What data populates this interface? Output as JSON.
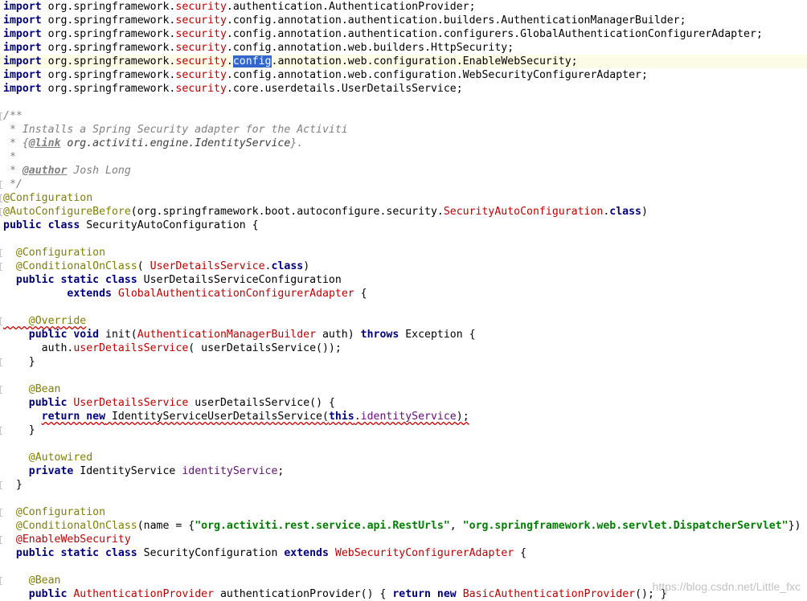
{
  "code_lines": [
    {
      "hl": false,
      "fold": false,
      "tokens": [
        {
          "t": "import",
          "c": "kw"
        },
        {
          "t": " org.springframework.",
          "c": "pkg"
        },
        {
          "t": "security",
          "c": "sec"
        },
        {
          "t": ".authentication.AuthenticationProvider;",
          "c": "pkg"
        }
      ]
    },
    {
      "hl": false,
      "fold": false,
      "tokens": [
        {
          "t": "import",
          "c": "kw"
        },
        {
          "t": " org.springframework.",
          "c": "pkg"
        },
        {
          "t": "security",
          "c": "sec"
        },
        {
          "t": ".config.annotation.authentication.builders.AuthenticationManagerBuilder;",
          "c": "pkg"
        }
      ]
    },
    {
      "hl": false,
      "fold": false,
      "tokens": [
        {
          "t": "import",
          "c": "kw"
        },
        {
          "t": " org.springframework.",
          "c": "pkg"
        },
        {
          "t": "security",
          "c": "sec"
        },
        {
          "t": ".config.annotation.authentication.configurers.GlobalAuthenticationConfigurerAdapter;",
          "c": "pkg"
        }
      ]
    },
    {
      "hl": false,
      "fold": false,
      "tokens": [
        {
          "t": "import",
          "c": "kw"
        },
        {
          "t": " org.springframework.",
          "c": "pkg"
        },
        {
          "t": "security",
          "c": "sec"
        },
        {
          "t": ".config.annotation.web.builders.HttpSecurity;",
          "c": "pkg"
        }
      ]
    },
    {
      "hl": true,
      "fold": false,
      "tokens": [
        {
          "t": "import",
          "c": "kw"
        },
        {
          "t": " org.springframework.",
          "c": "pkg"
        },
        {
          "t": "security",
          "c": "sec"
        },
        {
          "t": ".",
          "c": "pkg"
        },
        {
          "t": "config",
          "c": "sel"
        },
        {
          "t": ".annotation.web.configuration.EnableWebSecurity;",
          "c": "pkg"
        }
      ]
    },
    {
      "hl": false,
      "fold": false,
      "tokens": [
        {
          "t": "import",
          "c": "kw"
        },
        {
          "t": " org.springframework.",
          "c": "pkg"
        },
        {
          "t": "security",
          "c": "sec"
        },
        {
          "t": ".config.annotation.web.configuration.WebSecurityConfigurerAdapter;",
          "c": "pkg"
        }
      ]
    },
    {
      "hl": false,
      "fold": false,
      "tokens": [
        {
          "t": "import",
          "c": "kw"
        },
        {
          "t": " org.springframework.",
          "c": "pkg"
        },
        {
          "t": "security",
          "c": "sec"
        },
        {
          "t": ".core.userdetails.UserDetailsService;",
          "c": "pkg"
        }
      ]
    },
    {
      "hl": false,
      "fold": false,
      "tokens": []
    },
    {
      "hl": false,
      "fold": true,
      "tokens": [
        {
          "t": "/**",
          "c": "cmt"
        }
      ]
    },
    {
      "hl": false,
      "fold": false,
      "tokens": [
        {
          "t": " * Installs a Spring Security adapter for the Activiti",
          "c": "cmt"
        }
      ]
    },
    {
      "hl": false,
      "fold": false,
      "tokens": [
        {
          "t": " * {",
          "c": "cmt"
        },
        {
          "t": "@link",
          "c": "doctag"
        },
        {
          "t": " org.activiti.engine.IdentityService",
          "c": "docref"
        },
        {
          "t": "}.",
          "c": "cmt"
        }
      ]
    },
    {
      "hl": false,
      "fold": false,
      "tokens": [
        {
          "t": " *",
          "c": "cmt"
        }
      ]
    },
    {
      "hl": false,
      "fold": false,
      "tokens": [
        {
          "t": " * ",
          "c": "cmt"
        },
        {
          "t": "@author",
          "c": "doctag"
        },
        {
          "t": " Josh Long",
          "c": "cmt"
        }
      ]
    },
    {
      "hl": false,
      "fold": true,
      "tokens": [
        {
          "t": " */",
          "c": "cmt"
        }
      ]
    },
    {
      "hl": false,
      "fold": true,
      "tokens": [
        {
          "t": "@Configuration",
          "c": "ann"
        }
      ]
    },
    {
      "hl": false,
      "fold": true,
      "tokens": [
        {
          "t": "@AutoConfigureBefore",
          "c": "ann"
        },
        {
          "t": "(org.springframework.boot.autoconfigure.security.",
          "c": "plain"
        },
        {
          "t": "SecurityAutoConfiguration",
          "c": "ref"
        },
        {
          "t": ".",
          "c": "plain"
        },
        {
          "t": "class",
          "c": "kw"
        },
        {
          "t": ")",
          "c": "plain"
        }
      ]
    },
    {
      "hl": false,
      "fold": false,
      "tokens": [
        {
          "t": "public class",
          "c": "kw"
        },
        {
          "t": " SecurityAutoConfiguration {",
          "c": "plain"
        }
      ]
    },
    {
      "hl": false,
      "fold": false,
      "tokens": []
    },
    {
      "hl": false,
      "fold": true,
      "tokens": [
        {
          "t": "  @Configuration",
          "c": "ann"
        }
      ]
    },
    {
      "hl": false,
      "fold": true,
      "tokens": [
        {
          "t": "  @ConditionalOnClass",
          "c": "ann"
        },
        {
          "t": "( ",
          "c": "plain"
        },
        {
          "t": "UserDetailsService",
          "c": "ref"
        },
        {
          "t": ".",
          "c": "plain"
        },
        {
          "t": "class",
          "c": "kw"
        },
        {
          "t": ")",
          "c": "plain"
        }
      ]
    },
    {
      "hl": false,
      "fold": false,
      "tokens": [
        {
          "t": "  public static class",
          "c": "kw"
        },
        {
          "t": " UserDetailsServiceConfiguration",
          "c": "plain"
        }
      ]
    },
    {
      "hl": false,
      "fold": false,
      "tokens": [
        {
          "t": "          extends",
          "c": "kw"
        },
        {
          "t": " ",
          "c": "plain"
        },
        {
          "t": "GlobalAuthenticationConfigurerAdapter",
          "c": "ref"
        },
        {
          "t": " {",
          "c": "plain"
        }
      ]
    },
    {
      "hl": false,
      "fold": false,
      "tokens": []
    },
    {
      "hl": false,
      "fold": true,
      "tokens": [
        {
          "t": "    @Override",
          "c": "ann-sq"
        }
      ]
    },
    {
      "hl": false,
      "fold": false,
      "tokens": [
        {
          "t": "    public void",
          "c": "kw"
        },
        {
          "t": " init(",
          "c": "plain"
        },
        {
          "t": "AuthenticationManagerBuilder",
          "c": "ref"
        },
        {
          "t": " auth) ",
          "c": "plain"
        },
        {
          "t": "throws",
          "c": "kw"
        },
        {
          "t": " Exception {",
          "c": "plain"
        }
      ]
    },
    {
      "hl": false,
      "fold": false,
      "tokens": [
        {
          "t": "      auth.",
          "c": "plain"
        },
        {
          "t": "userDetailsService",
          "c": "ref"
        },
        {
          "t": "( userDetailsService());",
          "c": "plain"
        }
      ]
    },
    {
      "hl": false,
      "fold": true,
      "tokens": [
        {
          "t": "    }",
          "c": "plain"
        }
      ]
    },
    {
      "hl": false,
      "fold": false,
      "tokens": []
    },
    {
      "hl": false,
      "fold": true,
      "tokens": [
        {
          "t": "    @Bean",
          "c": "ann"
        }
      ]
    },
    {
      "hl": false,
      "fold": false,
      "tokens": [
        {
          "t": "    public",
          "c": "kw"
        },
        {
          "t": " ",
          "c": "plain"
        },
        {
          "t": "UserDetailsService",
          "c": "ref"
        },
        {
          "t": " userDetailsService() {",
          "c": "plain"
        }
      ]
    },
    {
      "hl": false,
      "fold": false,
      "tokens": [
        {
          "t": "      ",
          "c": "plain"
        },
        {
          "t": "return new",
          "c": "kw-sq"
        },
        {
          "t": " IdentityServiceUserDetailsService(",
          "c": "plain-sq"
        },
        {
          "t": "this",
          "c": "kw-sq"
        },
        {
          "t": ".",
          "c": "plain-sq"
        },
        {
          "t": "identityService",
          "c": "field-sq"
        },
        {
          "t": ");",
          "c": "plain-sq"
        }
      ]
    },
    {
      "hl": false,
      "fold": true,
      "tokens": [
        {
          "t": "    }",
          "c": "plain"
        }
      ]
    },
    {
      "hl": false,
      "fold": false,
      "tokens": []
    },
    {
      "hl": false,
      "fold": false,
      "tokens": [
        {
          "t": "    @Autowired",
          "c": "ann"
        }
      ]
    },
    {
      "hl": false,
      "fold": false,
      "tokens": [
        {
          "t": "    private",
          "c": "kw"
        },
        {
          "t": " IdentityService ",
          "c": "plain"
        },
        {
          "t": "identityService",
          "c": "field"
        },
        {
          "t": ";",
          "c": "plain"
        }
      ]
    },
    {
      "hl": false,
      "fold": true,
      "tokens": [
        {
          "t": "  }",
          "c": "plain"
        }
      ]
    },
    {
      "hl": false,
      "fold": false,
      "tokens": []
    },
    {
      "hl": false,
      "fold": true,
      "tokens": [
        {
          "t": "  @Configuration",
          "c": "ann"
        }
      ]
    },
    {
      "hl": false,
      "fold": false,
      "tokens": [
        {
          "t": "  @ConditionalOnClass",
          "c": "ann"
        },
        {
          "t": "(name = {",
          "c": "plain"
        },
        {
          "t": "\"org.activiti.rest.service.api.RestUrls\"",
          "c": "str"
        },
        {
          "t": ", ",
          "c": "plain"
        },
        {
          "t": "\"org.springframework.web.servlet.DispatcherServlet\"",
          "c": "str"
        },
        {
          "t": "})",
          "c": "plain"
        }
      ]
    },
    {
      "hl": false,
      "fold": true,
      "tokens": [
        {
          "t": "  @EnableWebSecurity",
          "c": "ref"
        }
      ]
    },
    {
      "hl": false,
      "fold": false,
      "tokens": [
        {
          "t": "  public static class",
          "c": "kw"
        },
        {
          "t": " SecurityConfiguration ",
          "c": "plain"
        },
        {
          "t": "extends",
          "c": "kw"
        },
        {
          "t": " ",
          "c": "plain"
        },
        {
          "t": "WebSecurityConfigurerAdapter",
          "c": "ref"
        },
        {
          "t": " {",
          "c": "plain"
        }
      ]
    },
    {
      "hl": false,
      "fold": false,
      "tokens": []
    },
    {
      "hl": false,
      "fold": true,
      "tokens": [
        {
          "t": "    @Bean",
          "c": "ann"
        }
      ]
    },
    {
      "hl": false,
      "fold": false,
      "tokens": [
        {
          "t": "    public",
          "c": "kw"
        },
        {
          "t": " ",
          "c": "plain"
        },
        {
          "t": "AuthenticationProvider",
          "c": "ref"
        },
        {
          "t": " authenticationProvider() { ",
          "c": "plain"
        },
        {
          "t": "return new",
          "c": "kw"
        },
        {
          "t": " ",
          "c": "plain"
        },
        {
          "t": "BasicAuthenticationProvider",
          "c": "ref"
        },
        {
          "t": "(); }",
          "c": "plain"
        }
      ]
    }
  ],
  "watermark": "https://blog.csdn.net/Little_fxc"
}
